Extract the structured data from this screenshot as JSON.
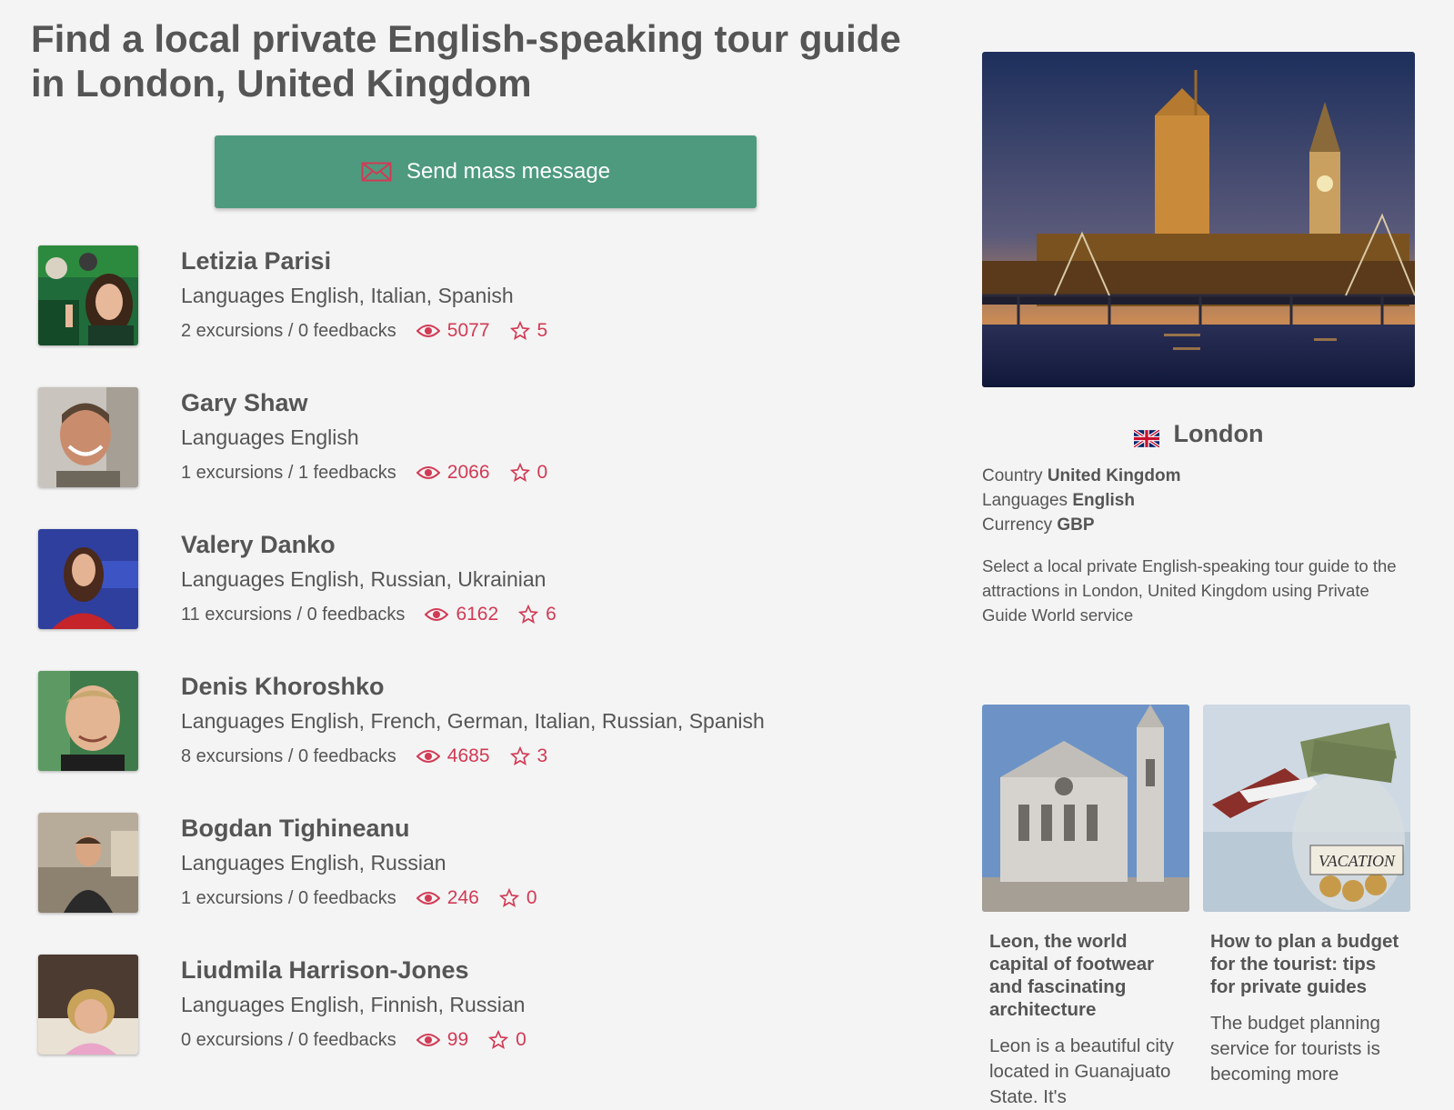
{
  "page_title": "Find a local private English-speaking tour guide in London, United Kingdom",
  "mass_message_button": "Send mass message",
  "guides": [
    {
      "name": "Letizia Parisi",
      "languages": "Languages English, Italian, Spanish",
      "excursions": "2 excursions / 0 feedbacks",
      "views": "5077",
      "rating": "5"
    },
    {
      "name": "Gary Shaw",
      "languages": "Languages English",
      "excursions": "1 excursions / 1 feedbacks",
      "views": "2066",
      "rating": "0"
    },
    {
      "name": "Valery Danko",
      "languages": "Languages English, Russian, Ukrainian",
      "excursions": "11 excursions / 0 feedbacks",
      "views": "6162",
      "rating": "6"
    },
    {
      "name": "Denis Khoroshko",
      "languages": "Languages English, French, German, Italian, Russian, Spanish",
      "excursions": "8 excursions / 0 feedbacks",
      "views": "4685",
      "rating": "3"
    },
    {
      "name": "Bogdan Tighineanu",
      "languages": "Languages English, Russian",
      "excursions": "1 excursions / 0 feedbacks",
      "views": "246",
      "rating": "0"
    },
    {
      "name": "Liudmila Harrison-Jones",
      "languages": "Languages English, Finnish, Russian",
      "excursions": "0 excursions / 0 feedbacks",
      "views": "99",
      "rating": "0"
    }
  ],
  "city": {
    "name": "London",
    "country_label": "Country",
    "country": "United Kingdom",
    "languages_label": "Languages",
    "languages": "English",
    "currency_label": "Currency",
    "currency": "GBP",
    "description": "Select a local private English-speaking tour guide to the attractions in London, United Kingdom using Private Guide World service"
  },
  "articles": [
    {
      "title": "Leon, the world capital of footwear and fascinating architecture",
      "text": "Leon is a beautiful city located in Guanajuato State. It's"
    },
    {
      "title": "How to plan a budget for the tourist: tips for private guides",
      "text": "The budget planning service for tourists is becoming more"
    }
  ],
  "article_thumb_label": "VACATION",
  "colors": {
    "accent_green": "#4e9a7f",
    "accent_red": "#d23a55",
    "text": "#555555",
    "background": "#f4f4f4"
  },
  "icons": {
    "mail": "envelope-icon",
    "views": "eye-icon",
    "rating": "star-icon",
    "flag": "uk-flag-icon"
  }
}
